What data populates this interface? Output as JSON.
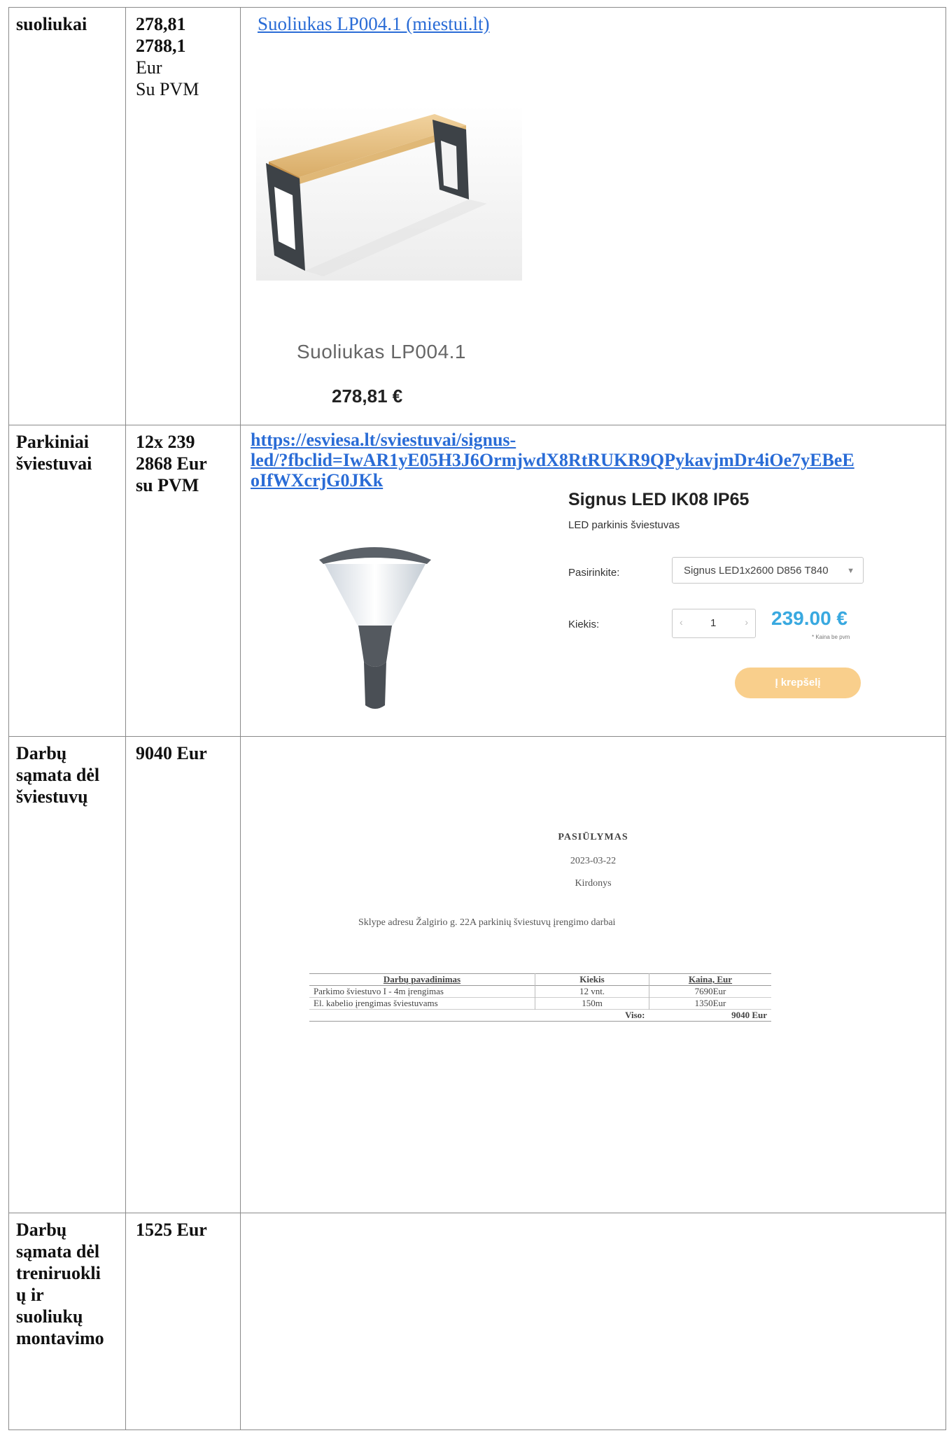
{
  "rows": [
    {
      "label": "suoliukai",
      "value_lines": [
        "278,81",
        "2788,1",
        "Eur",
        "Su PVM"
      ],
      "link_text": "Suoliukas LP004.1 (miestui.lt)",
      "product": {
        "name": "Suoliukas LP004.1",
        "price": "278,81 €"
      }
    },
    {
      "label_lines": [
        "Parkiniai",
        "šviestuvai"
      ],
      "value_lines": [
        "12x 239",
        "2868 Eur",
        "su PVM"
      ],
      "link_lines": [
        "https://esviesa.lt/sviestuvai/signus-",
        "led/?fbclid=IwAR1yE05H3J6OrmjwdX8RtRUKR9QPykavjmDr4iOe7yEBeE",
        "oIfWXcrjG0JKk"
      ],
      "product": {
        "title": "Signus LED IK08 IP65",
        "subtitle": "LED parkinis šviestuvas",
        "select_label": "Pasirinkite:",
        "select_value": "Signus LED1x2600 D856 T840",
        "qty_label": "Kiekis:",
        "qty_value": "1",
        "price": "239.00 €",
        "price_note": "* Kaina be pvm",
        "cart_button": "Į krepšelį",
        "accent_color": "#39a9e0",
        "button_color": "#f9cf8c"
      }
    },
    {
      "label_lines": [
        "Darbų",
        "sąmata dėl",
        "šviestuvų"
      ],
      "value": "9040 Eur",
      "doc": {
        "title": "PASIŪLYMAS",
        "date": "2023-03-22",
        "place": "Kirdonys",
        "intro": "Sklype adresu Žalgirio g. 22A parkinių šviestuvų įrengimo darbai",
        "headers": [
          "Darbų pavadinimas",
          "Kiekis",
          "Kaina, Eur"
        ],
        "items": [
          [
            "Parkimo šviestuvo I - 4m įrengimas",
            "12 vnt.",
            "7690Eur"
          ],
          [
            "El. kabelio įrengimas šviestuvams",
            "150m",
            "1350Eur"
          ]
        ],
        "total_label": "Viso:",
        "total_value": "9040 Eur"
      }
    },
    {
      "label_lines": [
        "Darbų",
        "sąmata dėl",
        "treniruokli",
        "ų ir",
        "suoliukų",
        "montavimo"
      ],
      "value": "1525 Eur"
    }
  ]
}
